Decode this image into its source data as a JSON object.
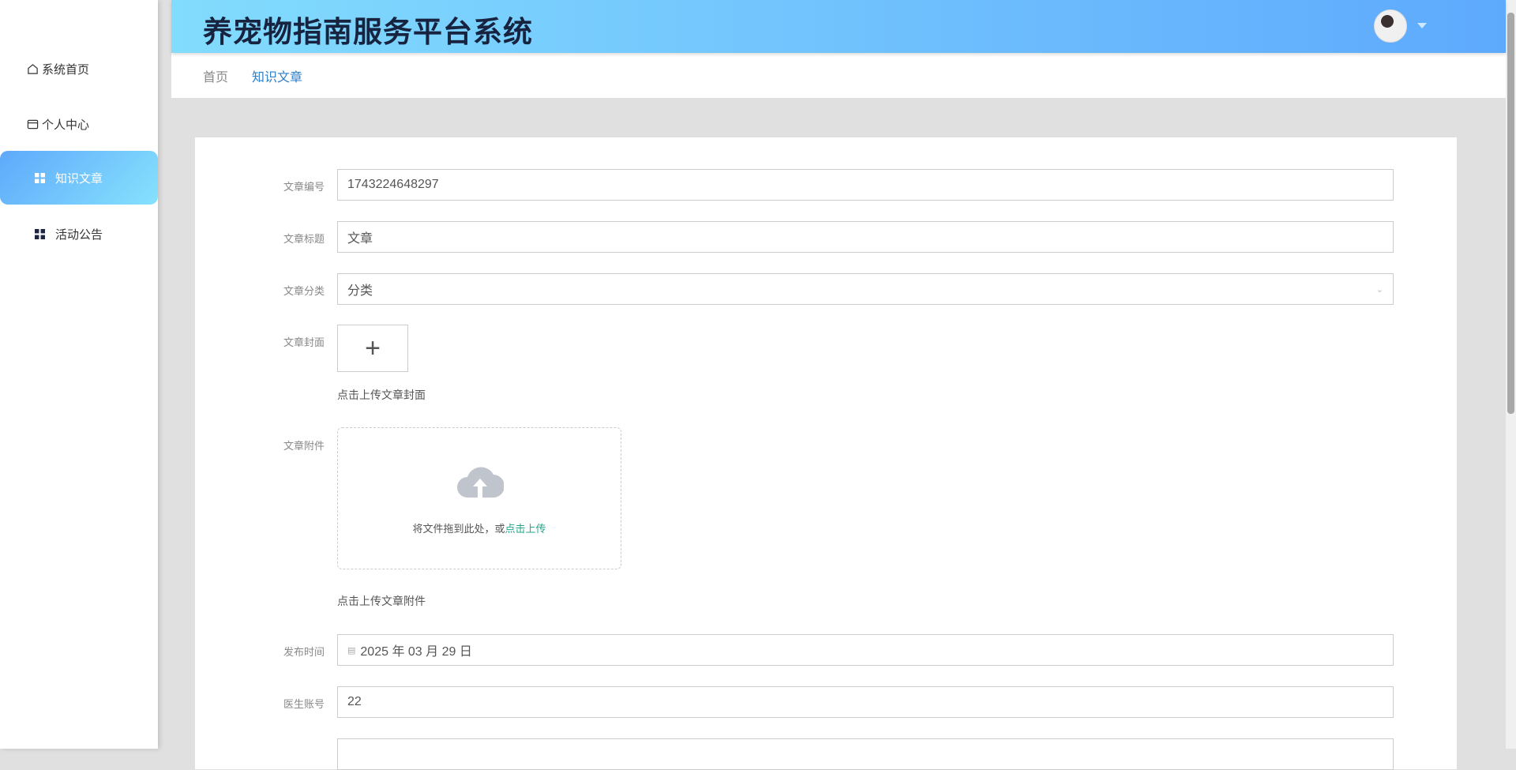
{
  "header": {
    "title": "养宠物指南服务平台系统"
  },
  "sidebar": {
    "items": [
      {
        "label": "系统首页"
      },
      {
        "label": "个人中心"
      },
      {
        "label": "知识文章"
      },
      {
        "label": "活动公告"
      }
    ]
  },
  "breadcrumb": {
    "items": [
      "首页",
      "知识文章"
    ]
  },
  "form": {
    "article_no": {
      "label": "文章编号",
      "value": "1743224648297"
    },
    "article_title": {
      "label": "文章标题",
      "value": "文章"
    },
    "category": {
      "label": "文章分类",
      "value": "分类"
    },
    "cover": {
      "label": "文章封面",
      "hint": "点击上传文章封面"
    },
    "attachment": {
      "label": "文章附件",
      "drop_text": "将文件拖到此处，或",
      "drop_link": "点击上传",
      "hint": "点击上传文章附件"
    },
    "publish_time": {
      "label": "发布时间",
      "value": "2025 年 03 月 29 日"
    },
    "doctor_account": {
      "label": "医生账号",
      "value": "22"
    }
  }
}
